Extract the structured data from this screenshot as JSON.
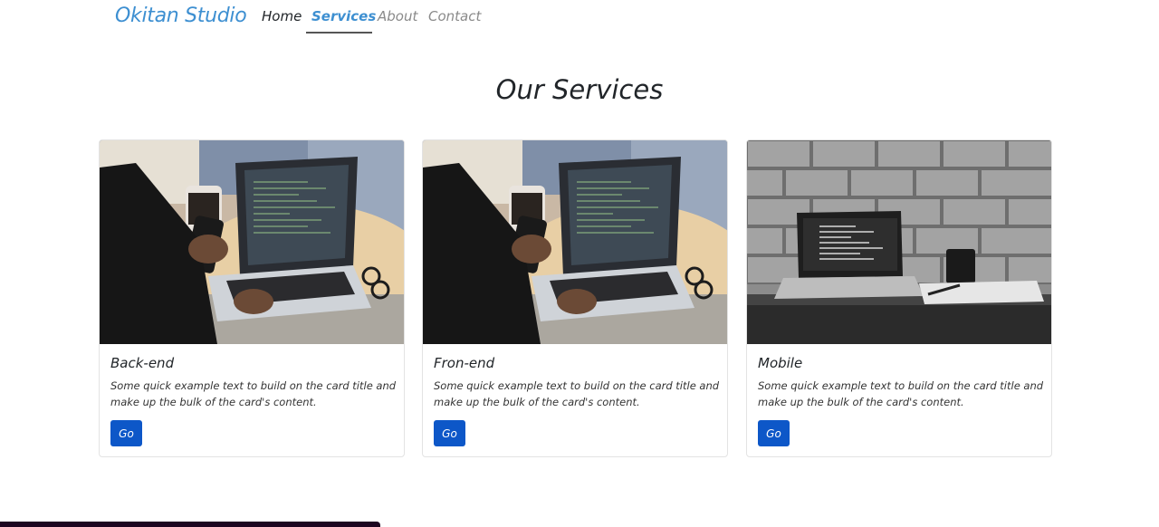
{
  "navbar": {
    "brand": "Okitan Studio",
    "links": [
      {
        "label": "Home"
      },
      {
        "label": "Services"
      },
      {
        "label": "About"
      },
      {
        "label": "Contact"
      }
    ]
  },
  "services": {
    "title": "Our Services",
    "cards": [
      {
        "title": "Back-end",
        "text": "Some quick example text to build on the card title and make up the bulk of the card's content.",
        "button": "Go"
      },
      {
        "title": "Fron-end",
        "text": "Some quick example text to build on the card title and make up the bulk of the card's content.",
        "button": "Go"
      },
      {
        "title": "Mobile",
        "text": "Some quick example text to build on the card title and make up the bulk of the card's content.",
        "button": "Go"
      }
    ]
  },
  "colors": {
    "brand": "#3d8fd1",
    "button": "#0d57c8",
    "active_link": "#3d8fd1"
  }
}
